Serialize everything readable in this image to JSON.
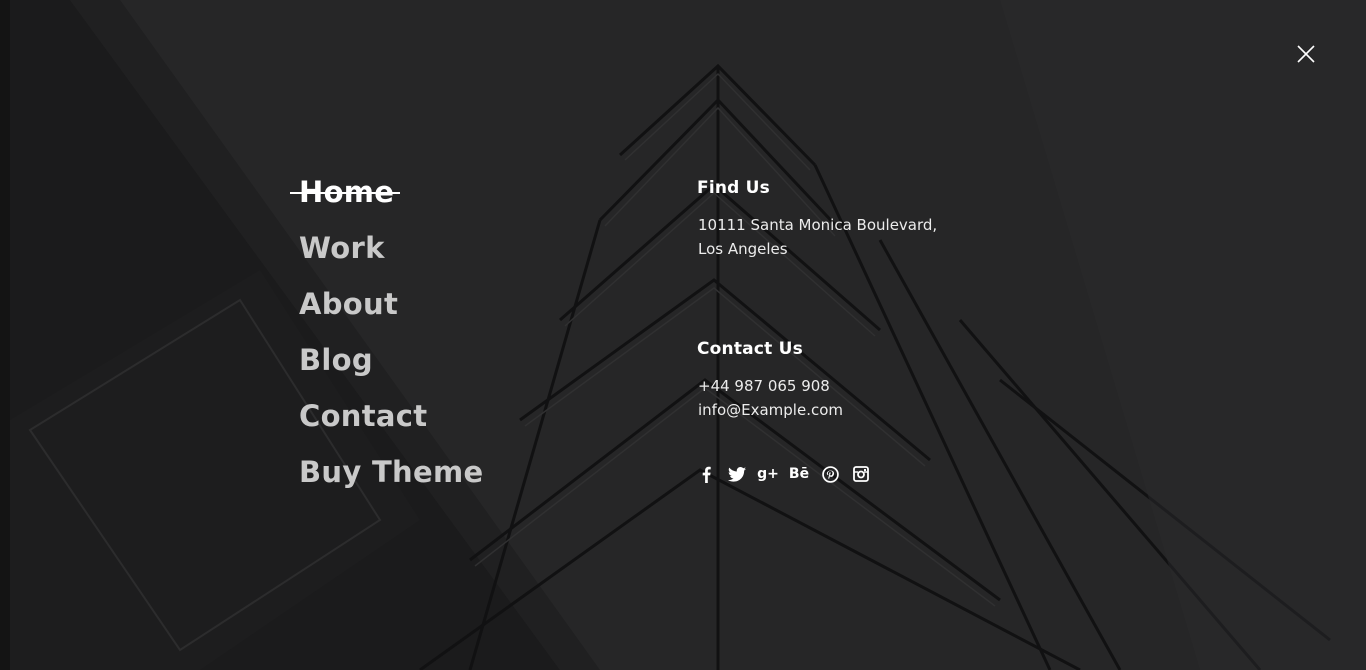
{
  "close": {
    "icon": "close-icon"
  },
  "menu": {
    "items": [
      {
        "label": "Home",
        "active": true
      },
      {
        "label": "Work"
      },
      {
        "label": "About"
      },
      {
        "label": "Blog"
      },
      {
        "label": "Contact"
      },
      {
        "label": "Buy Theme"
      }
    ]
  },
  "find_us": {
    "heading": "Find Us",
    "address_line1": "10111 Santa Monica Boulevard,",
    "address_line2": "Los Angeles"
  },
  "contact_us": {
    "heading": "Contact Us",
    "phone": "+44 987 065 908",
    "email": "info@Example.com"
  },
  "social": {
    "icons": [
      "facebook-icon",
      "twitter-icon",
      "google-plus-icon",
      "behance-icon",
      "pinterest-icon",
      "instagram-icon"
    ],
    "behance_text": "Bē",
    "google_plus_text": "g+"
  },
  "colors": {
    "background": "#262627",
    "text": "#ffffff",
    "menu_inactive": "#c9c9c9"
  }
}
